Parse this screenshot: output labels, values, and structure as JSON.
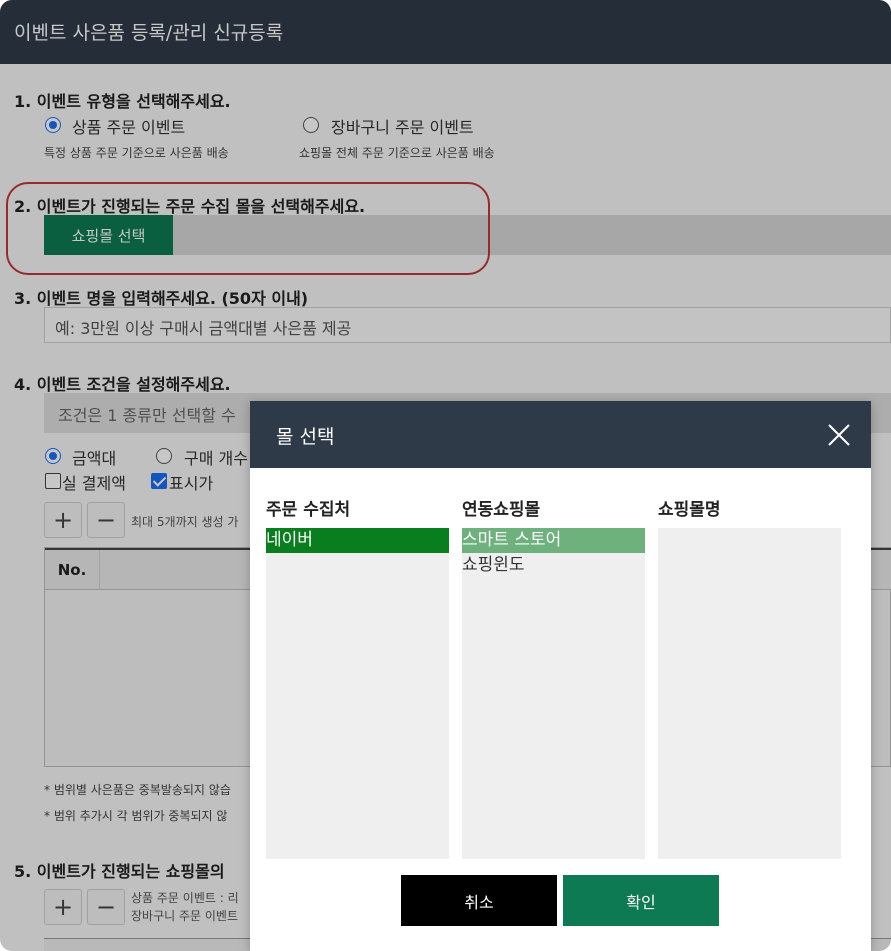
{
  "window": {
    "title": "이벤트 사은품 등록/관리 신규등록"
  },
  "section1": {
    "title": "1.  이벤트 유형을 선택해주세요.",
    "option_a": {
      "label": "상품 주문 이벤트",
      "desc": "특정 상품 주문 기준으로 사은품 배송",
      "checked": true
    },
    "option_b": {
      "label": "장바구니 주문 이벤트",
      "desc": "쇼핑몰 전체 주문 기준으로 사은품 배송",
      "checked": false
    }
  },
  "section2": {
    "title": "2.  이벤트가 진행되는 주문 수집 몰을 선택해주세요.",
    "button_label": "쇼핑몰 선택"
  },
  "section3": {
    "title": "3.  이벤트 명을 입력해주세요. (50자 이내)",
    "input_placeholder": "예: 3만원 이상 구매시 금액대별 사은품 제공"
  },
  "section4": {
    "title": "4.  이벤트 조건을 설정해주세요.",
    "condition_notice": "조건은 1 종류만 선택할 수",
    "radio_amount": "금액대",
    "radio_count": "구매 개수",
    "check_actual": "실 결제액",
    "check_display": "표시가",
    "check_actual_checked": false,
    "check_display_checked": true,
    "add_label": "+",
    "remove_label": "−",
    "limit_note": "최대 5개까지 생성 가",
    "table_header_no": "No.",
    "note_1": "* 범위별 사은품은 중복발송되지 않습",
    "note_2": "* 범위 추가시 각 범위가 중복되지 않"
  },
  "section5": {
    "title": "5.  이벤트가 진행되는 쇼핑몰의",
    "add_label": "+",
    "remove_label": "−",
    "note_1": "상품 주문 이벤트 : 리",
    "note_2": "장바구니 주문 이벤트"
  },
  "modal": {
    "title": "몰 선택",
    "col1_title": "주문 수집처",
    "col2_title": "연동쇼핑몰",
    "col3_title": "쇼핑몰명",
    "col1_items": [
      "네이버"
    ],
    "col2_items": [
      "스마트 스토어",
      "쇼핑윈도"
    ],
    "cancel_label": "취소",
    "ok_label": "확인"
  },
  "colors": {
    "header_bg": "#2f3a48",
    "primary_green": "#0d7a53",
    "selected_dark_green": "#087e1f",
    "selected_light_green": "#6fb17d",
    "highlight_red": "#c0373f"
  }
}
